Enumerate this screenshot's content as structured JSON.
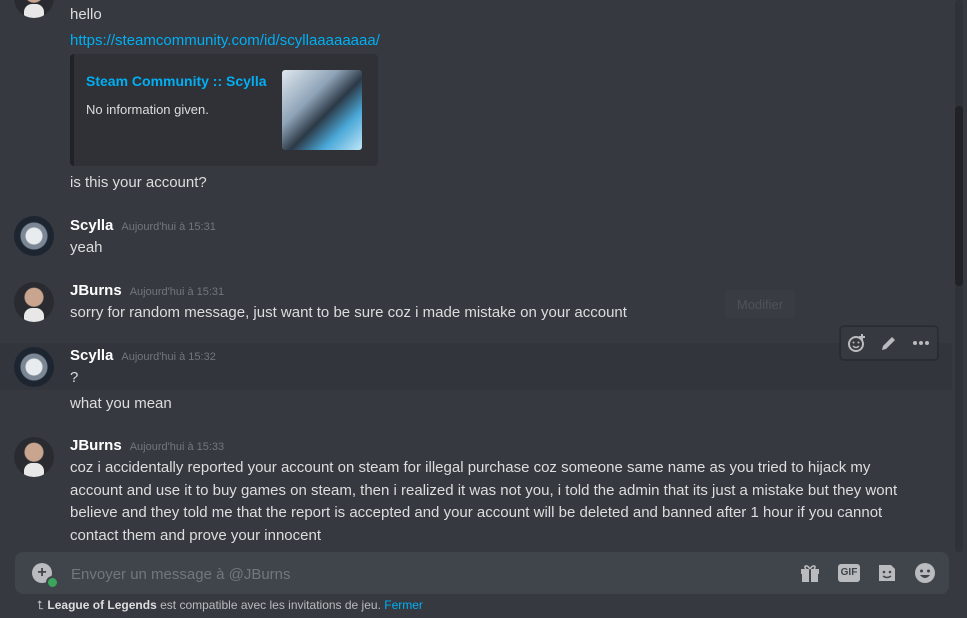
{
  "messages_top": {
    "lines": [
      "hello",
      "is this your account?"
    ],
    "link": "https://steamcommunity.com/id/scyllaaaaaaaa/",
    "embed": {
      "title": "Steam Community :: Scylla",
      "description": "No information given."
    }
  },
  "msg_scylla_1": {
    "author": "Scylla",
    "time": "Aujourd'hui à 15:31",
    "text": "yeah"
  },
  "msg_jburns_1": {
    "author": "JBurns",
    "time": "Aujourd'hui à 15:31",
    "text": "sorry for random message, just want to be sure coz i made mistake on your account"
  },
  "msg_scylla_2": {
    "author": "Scylla",
    "time": "Aujourd'hui à 15:32",
    "lines": [
      "?",
      "what you mean"
    ]
  },
  "msg_jburns_2": {
    "author": "JBurns",
    "time": "Aujourd'hui à 15:33",
    "text": "coz i accidentally reported your account on steam for illegal purchase coz someone same name as you tried to hijack my account and use it to buy games on steam, then i realized it was not you, i told the admin that its just a mistake but they wont believe and they told me that the report is accepted and your account will be deleted and banned after 1 hour if you cannot contact them and prove your innocent"
  },
  "ghost_button": "Modifier",
  "composer": {
    "placeholder": "Envoyer un message à @JBurns",
    "icons": [
      "gift-icon",
      "gif-icon",
      "sticker-icon",
      "emoji-icon"
    ],
    "gif_label": "GIF"
  },
  "footer": {
    "game": "League of Legends",
    "text": " est compatible avec les invitations de jeu. ",
    "close": "Fermer"
  },
  "colors": {
    "background": "#36393f",
    "link": "#00aff4",
    "username": "#ffffff",
    "timestamp": "#72767d"
  }
}
